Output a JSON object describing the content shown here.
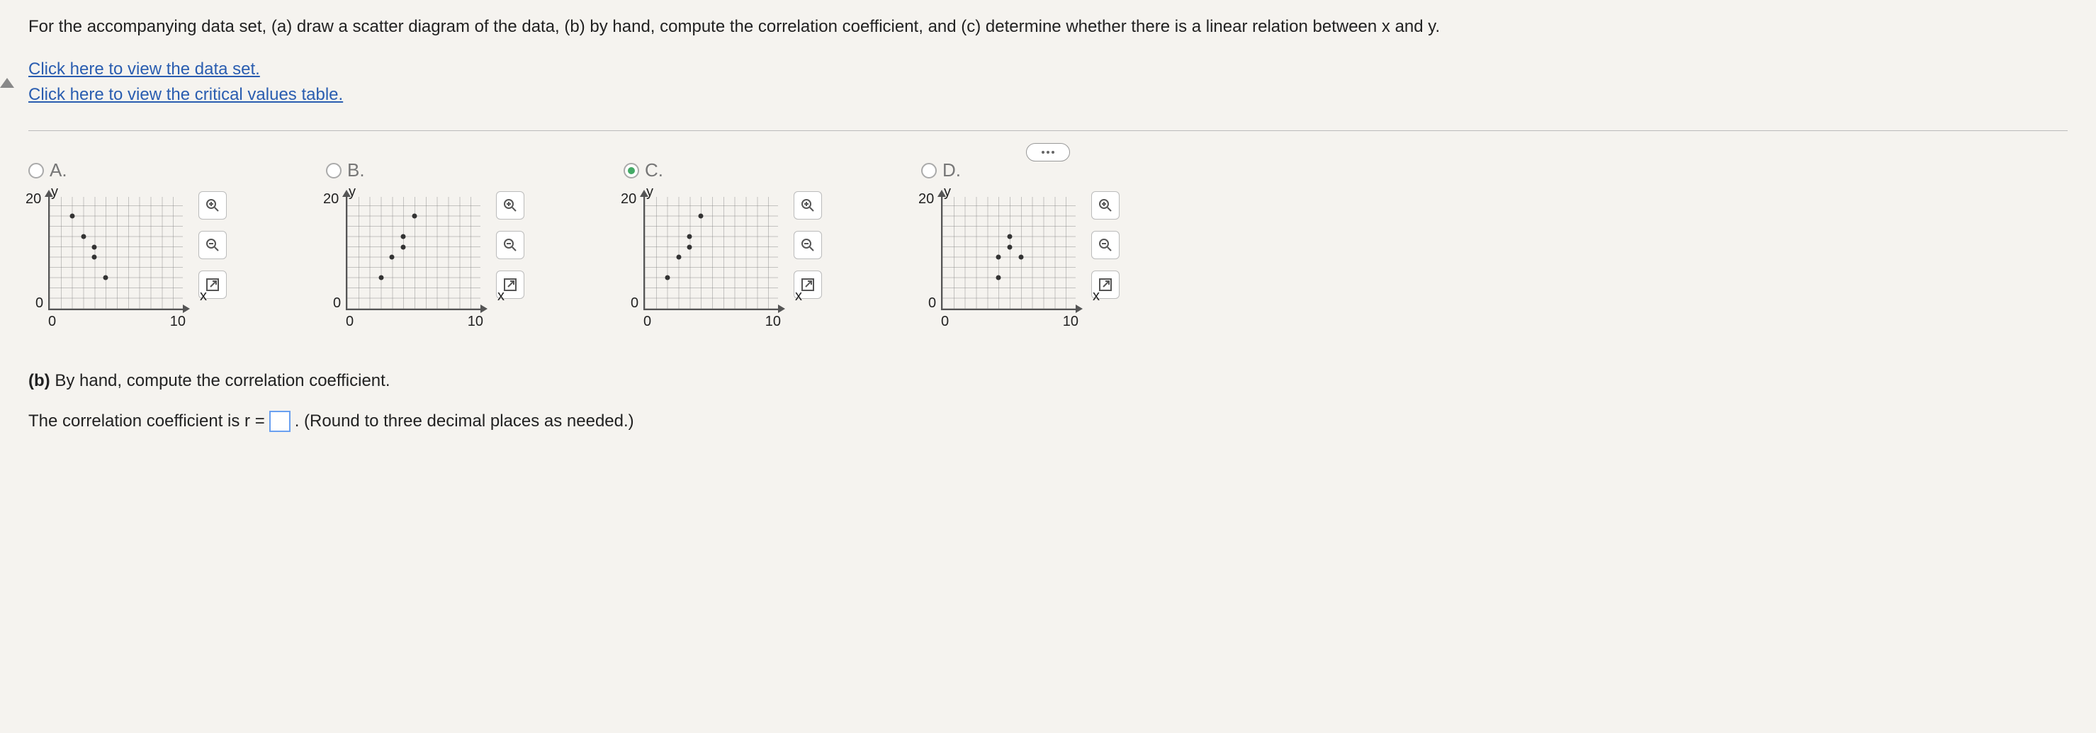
{
  "question_text": "For the accompanying data set, (a) draw a scatter diagram of the data, (b) by hand, compute the correlation coefficient, and (c) determine whether there is a linear relation between x and y.",
  "links": {
    "data_set": "Click here to view the data set.",
    "crit_table": "Click here to view the critical values table."
  },
  "axis": {
    "ylabel": "y",
    "xlabel": "x",
    "ymax": "20",
    "ymin": "0",
    "xmin": "0",
    "xmax": "10"
  },
  "options": {
    "a": {
      "label": "A.",
      "selected": false
    },
    "b": {
      "label": "B.",
      "selected": false
    },
    "c": {
      "label": "C.",
      "selected": true
    },
    "d": {
      "label": "D.",
      "selected": false
    }
  },
  "chart_data": [
    {
      "type": "scatter",
      "option": "A",
      "xlabel": "x",
      "ylabel": "y",
      "xlim": [
        0,
        12
      ],
      "ylim": [
        0,
        22
      ],
      "points": [
        {
          "x": 2,
          "y": 18
        },
        {
          "x": 3,
          "y": 14
        },
        {
          "x": 4,
          "y": 12
        },
        {
          "x": 4,
          "y": 10
        },
        {
          "x": 5,
          "y": 6
        }
      ]
    },
    {
      "type": "scatter",
      "option": "B",
      "xlabel": "x",
      "ylabel": "y",
      "xlim": [
        0,
        12
      ],
      "ylim": [
        0,
        22
      ],
      "points": [
        {
          "x": 3,
          "y": 6
        },
        {
          "x": 4,
          "y": 10
        },
        {
          "x": 5,
          "y": 12
        },
        {
          "x": 5,
          "y": 14
        },
        {
          "x": 6,
          "y": 18
        }
      ]
    },
    {
      "type": "scatter",
      "option": "C",
      "xlabel": "x",
      "ylabel": "y",
      "xlim": [
        0,
        12
      ],
      "ylim": [
        0,
        22
      ],
      "points": [
        {
          "x": 2,
          "y": 6
        },
        {
          "x": 3,
          "y": 10
        },
        {
          "x": 4,
          "y": 12
        },
        {
          "x": 4,
          "y": 14
        },
        {
          "x": 5,
          "y": 18
        }
      ]
    },
    {
      "type": "scatter",
      "option": "D",
      "xlabel": "x",
      "ylabel": "y",
      "xlim": [
        0,
        12
      ],
      "ylim": [
        0,
        22
      ],
      "points": [
        {
          "x": 5,
          "y": 6
        },
        {
          "x": 5,
          "y": 10
        },
        {
          "x": 6,
          "y": 12
        },
        {
          "x": 6,
          "y": 14
        },
        {
          "x": 7,
          "y": 10
        }
      ]
    }
  ],
  "tools": {
    "zoom_in": "+",
    "zoom_out": "−",
    "expand": "⤢"
  },
  "part_b": {
    "heading_prefix": "(b)",
    "heading_text": " By hand, compute the correlation coefficient.",
    "answer_pre": "The correlation coefficient is r = ",
    "answer_post": ". (Round to three decimal places as needed.)",
    "input_value": ""
  }
}
